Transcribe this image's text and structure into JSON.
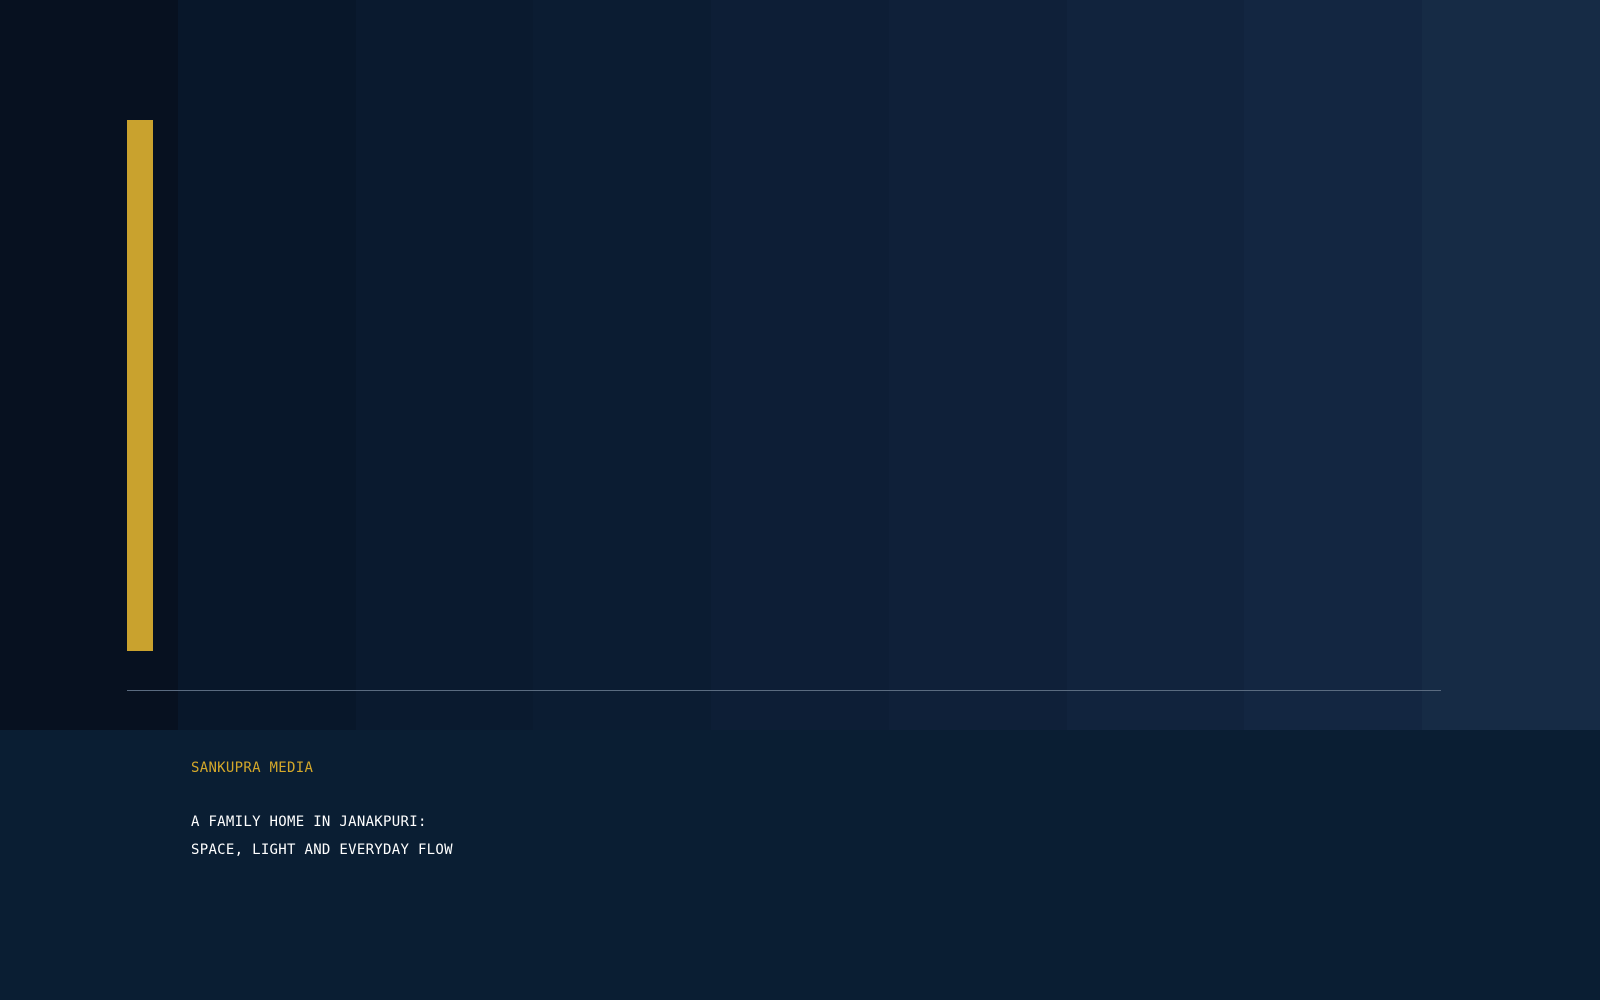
{
  "colors": {
    "accent": "#c9a22e",
    "brand_text": "#d4a82a",
    "footer_bg": "#0a1e33",
    "hero_gradient": [
      "#071120",
      "#08172a",
      "#0a1a2f",
      "#0b1c32",
      "#0d1e36",
      "#0f2039",
      "#11233d",
      "#132641",
      "#162b45"
    ]
  },
  "footer": {
    "brand": "SANKUPRA MEDIA",
    "headline_lines": [
      "A FAMILY HOME IN JANAKPURI:",
      "SPACE, LIGHT AND EVERYDAY FLOW"
    ]
  }
}
